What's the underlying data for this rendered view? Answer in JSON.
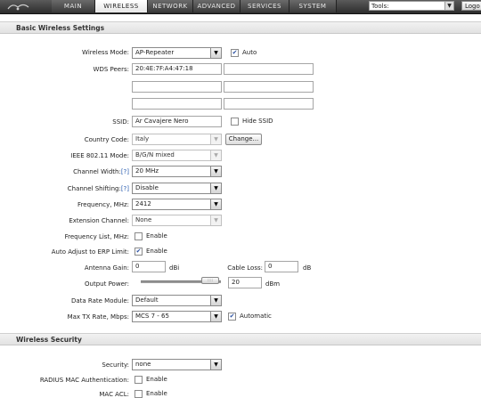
{
  "nav": {
    "tabs": [
      {
        "label": "MAIN"
      },
      {
        "label": "WIRELESS"
      },
      {
        "label": "NETWORK"
      },
      {
        "label": "ADVANCED"
      },
      {
        "label": "SERVICES"
      },
      {
        "label": "SYSTEM"
      }
    ],
    "active_tab": "WIRELESS",
    "tools_label": "Tools:",
    "logout_label": "Logo"
  },
  "basic": {
    "title": "Basic Wireless Settings",
    "wireless_mode": {
      "label": "Wireless Mode:",
      "value": "AP-Repeater",
      "auto_label": "Auto",
      "auto_checked": true
    },
    "wds_peers": {
      "label": "WDS Peers:",
      "values": [
        "20:4E:7F:A4:47:18",
        "",
        "",
        "",
        "",
        ""
      ]
    },
    "ssid": {
      "label": "SSID:",
      "value": "Ar Cavajere Nero",
      "hide_label": "Hide SSID",
      "hide_checked": false
    },
    "country": {
      "label": "Country Code:",
      "value": "Italy",
      "change_label": "Change..."
    },
    "ieee_mode": {
      "label": "IEEE 802.11 Mode:",
      "value": "B/G/N mixed"
    },
    "channel_width": {
      "label": "Channel Width:",
      "help": "[?]",
      "value": "20 MHz"
    },
    "channel_shifting": {
      "label": "Channel Shifting:",
      "help": "[?]",
      "value": "Disable"
    },
    "frequency": {
      "label": "Frequency, MHz:",
      "value": "2412"
    },
    "extension_channel": {
      "label": "Extension Channel:",
      "value": "None"
    },
    "frequency_list": {
      "label": "Frequency List, MHz:",
      "enable_label": "Enable",
      "checked": false
    },
    "erp_limit": {
      "label": "Auto Adjust to ERP Limit:",
      "enable_label": "Enable",
      "checked": true
    },
    "antenna_gain": {
      "label": "Antenna Gain:",
      "value": "0",
      "unit": "dBi"
    },
    "cable_loss": {
      "label": "Cable Loss:",
      "value": "0",
      "unit": "dB"
    },
    "output_power": {
      "label": "Output Power:",
      "value": "20",
      "unit": "dBm",
      "slider_thumb": "::::"
    },
    "data_rate_module": {
      "label": "Data Rate Module:",
      "value": "Default"
    },
    "max_tx_rate": {
      "label": "Max TX Rate, Mbps:",
      "value": "MCS 7 - 65",
      "automatic_label": "Automatic",
      "automatic_checked": true
    }
  },
  "security": {
    "title": "Wireless Security",
    "security": {
      "label": "Security:",
      "value": "none"
    },
    "radius_mac": {
      "label": "RADIUS MAC Authentication:",
      "enable_label": "Enable",
      "checked": false
    },
    "mac_acl": {
      "label": "MAC ACL:",
      "enable_label": "Enable",
      "checked": false
    }
  },
  "glyphs": {
    "check": "✔",
    "dropdown": "▼"
  },
  "colors": {
    "nav_dark": "#3a3a3a",
    "active_tab": "#ffffff",
    "help_link": "#2a5db0",
    "check": "#2a4fa0"
  }
}
